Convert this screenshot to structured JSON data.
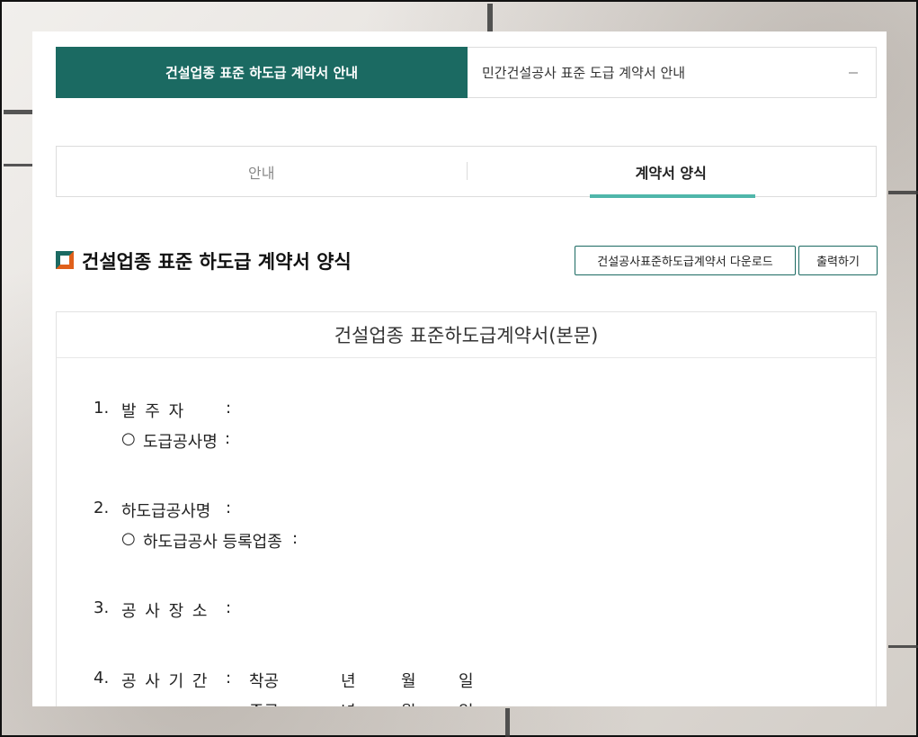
{
  "category_bar": {
    "active_label": "건설업종 표준 하도급 계약서 안내",
    "other_label": "민간건설공사 표준 도급 계약서 안내",
    "toggle_icon": "minus-icon"
  },
  "tabs": [
    {
      "label": "안내",
      "active": false
    },
    {
      "label": "계약서 양식",
      "active": true
    }
  ],
  "section": {
    "title": "건설업종 표준 하도급 계약서 양식",
    "download_label": "건설공사표준하도급계약서 다운로드",
    "print_label": "출력하기"
  },
  "document": {
    "title": "건설업종 표준하도급계약서(본문)",
    "items": [
      {
        "num": "1.",
        "label": "발  주  자",
        "colon": ":",
        "sub": {
          "bullet": "○",
          "label": "도급공사명",
          "colon": ":"
        }
      },
      {
        "num": "2.",
        "label": "하도급공사명",
        "colon": ":",
        "sub": {
          "bullet": "○",
          "label": "하도급공사 등록업종",
          "colon": ":"
        }
      },
      {
        "num": "3.",
        "label": "공  사  장  소",
        "colon": ":"
      },
      {
        "num": "4.",
        "label": "공  사  기  간",
        "colon": ":",
        "period": {
          "start": "착공",
          "year": "년",
          "month": "월",
          "day": "일",
          "end": "준공"
        }
      }
    ]
  },
  "colors": {
    "accent": "#1b6a62",
    "tab_underline": "#4fb6aa",
    "icon_orange": "#e0601b"
  }
}
